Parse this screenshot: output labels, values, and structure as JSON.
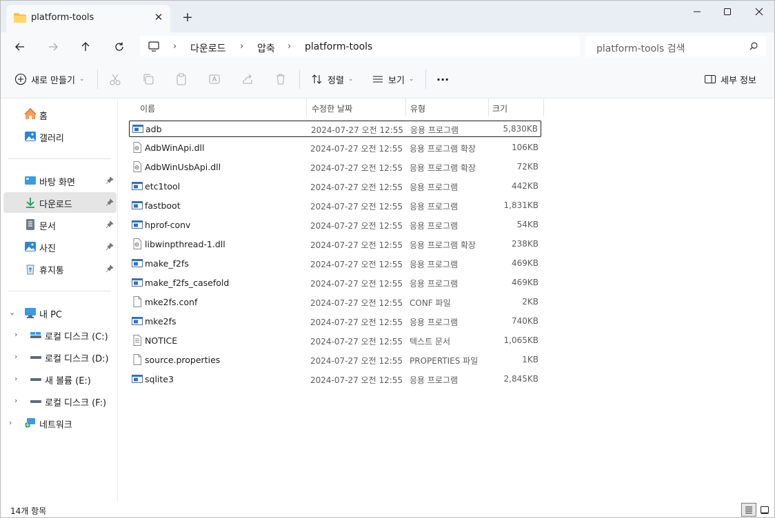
{
  "tab": {
    "title": "platform-tools",
    "close": "✕",
    "new_tab": "+"
  },
  "address": {
    "crumbs": [
      "다운로드",
      "압축",
      "platform-tools"
    ],
    "separator": "›"
  },
  "search": {
    "placeholder": "platform-tools 검색"
  },
  "toolbar": {
    "new_label": "새로 만들기",
    "sort_label": "정렬",
    "view_label": "보기",
    "more_label": "···",
    "details_label": "세부 정보"
  },
  "sidebar": {
    "quick": [
      {
        "label": "홈",
        "icon": "home-icon"
      },
      {
        "label": "갤러리",
        "icon": "gallery-icon"
      }
    ],
    "pinned": [
      {
        "label": "바탕 화면",
        "icon": "desktop-icon"
      },
      {
        "label": "다운로드",
        "icon": "download-icon",
        "selected": true
      },
      {
        "label": "문서",
        "icon": "documents-icon"
      },
      {
        "label": "사진",
        "icon": "pictures-icon"
      },
      {
        "label": "휴지통",
        "icon": "recycle-bin-icon"
      }
    ],
    "pc_label": "내 PC",
    "drives": [
      {
        "label": "로컬 디스크 (C:)"
      },
      {
        "label": "로컬 디스크 (D:)"
      },
      {
        "label": "새 볼륨 (E:)"
      },
      {
        "label": "로컬 디스크 (F:)"
      }
    ],
    "network_label": "네트워크"
  },
  "columns": {
    "name": "이름",
    "date": "수정한 날짜",
    "type": "유형",
    "size": "크기"
  },
  "files": [
    {
      "name": "adb",
      "date": "2024-07-27 오전 12:55",
      "type": "응용 프로그램",
      "size": "5,830KB",
      "kind": "exe"
    },
    {
      "name": "AdbWinApi.dll",
      "date": "2024-07-27 오전 12:55",
      "type": "응용 프로그램 확장",
      "size": "106KB",
      "kind": "dll"
    },
    {
      "name": "AdbWinUsbApi.dll",
      "date": "2024-07-27 오전 12:55",
      "type": "응용 프로그램 확장",
      "size": "72KB",
      "kind": "dll"
    },
    {
      "name": "etc1tool",
      "date": "2024-07-27 오전 12:55",
      "type": "응용 프로그램",
      "size": "442KB",
      "kind": "exe"
    },
    {
      "name": "fastboot",
      "date": "2024-07-27 오전 12:55",
      "type": "응용 프로그램",
      "size": "1,831KB",
      "kind": "exe"
    },
    {
      "name": "hprof-conv",
      "date": "2024-07-27 오전 12:55",
      "type": "응용 프로그램",
      "size": "54KB",
      "kind": "exe"
    },
    {
      "name": "libwinpthread-1.dll",
      "date": "2024-07-27 오전 12:55",
      "type": "응용 프로그램 확장",
      "size": "238KB",
      "kind": "dll"
    },
    {
      "name": "make_f2fs",
      "date": "2024-07-27 오전 12:55",
      "type": "응용 프로그램",
      "size": "469KB",
      "kind": "exe"
    },
    {
      "name": "make_f2fs_casefold",
      "date": "2024-07-27 오전 12:55",
      "type": "응용 프로그램",
      "size": "469KB",
      "kind": "exe"
    },
    {
      "name": "mke2fs.conf",
      "date": "2024-07-27 오전 12:55",
      "type": "CONF 파일",
      "size": "2KB",
      "kind": "file"
    },
    {
      "name": "mke2fs",
      "date": "2024-07-27 오전 12:55",
      "type": "응용 프로그램",
      "size": "740KB",
      "kind": "exe"
    },
    {
      "name": "NOTICE",
      "date": "2024-07-27 오전 12:55",
      "type": "텍스트 문서",
      "size": "1,065KB",
      "kind": "text"
    },
    {
      "name": "source.properties",
      "date": "2024-07-27 오전 12:55",
      "type": "PROPERTIES 파일",
      "size": "1KB",
      "kind": "file"
    },
    {
      "name": "sqlite3",
      "date": "2024-07-27 오전 12:55",
      "type": "응용 프로그램",
      "size": "2,845KB",
      "kind": "exe"
    }
  ],
  "status": {
    "item_count": "14개 항목"
  },
  "colors": {
    "folder": "#f5c344",
    "accent": "#0067c0",
    "selected_bg": "#e5e5e5"
  }
}
